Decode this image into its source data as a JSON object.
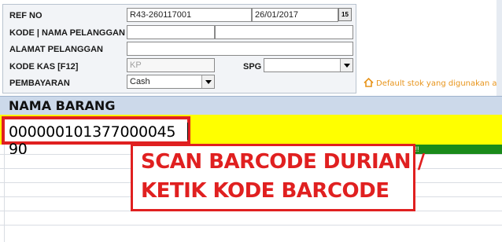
{
  "form": {
    "ref_no": {
      "label": "REF NO",
      "value": "R43-260117001",
      "date": "26/01/2017",
      "calendar_button": "15"
    },
    "kode_pelanggan": {
      "label": "KODE | NAMA PELANGGAN",
      "code_value": "",
      "name_value": ""
    },
    "alamat": {
      "label": "ALAMAT PELANGGAN",
      "value": ""
    },
    "kode_kas": {
      "label": "KODE KAS [F12]",
      "value": "KP"
    },
    "spg": {
      "label": "SPG",
      "value": ""
    },
    "pembayaran": {
      "label": "PEMBAYARAN",
      "value": "Cash"
    }
  },
  "default_stok_text": "Default stok yang digunakan ada",
  "nama_barang": {
    "header": "NAMA BARANG",
    "barcode_value": "000000101377000045 90"
  },
  "press_enter_text": "Press ENTER...!!!",
  "callout": {
    "line1": "SCAN BARCODE DURIAN /",
    "line2": "KETIK KODE BARCODE"
  },
  "colors": {
    "header_bar": "#ccd9ea",
    "input_row": "#ffff00",
    "highlight": "#e02020",
    "press_enter_bg": "#1a8a1a",
    "note_text": "#e8941a"
  }
}
